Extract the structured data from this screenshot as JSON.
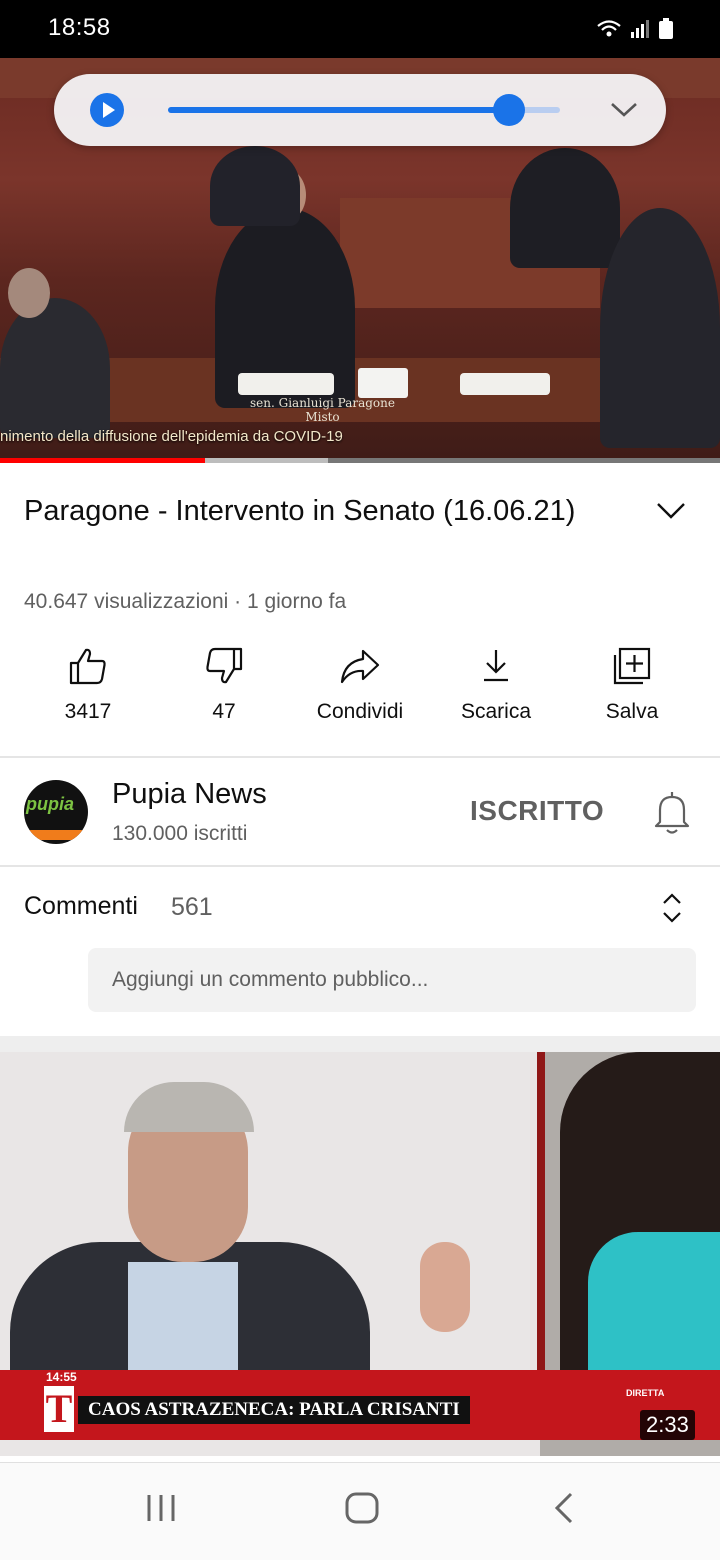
{
  "status_bar": {
    "time": "18:58",
    "icons": [
      "wifi-icon",
      "signal-icon",
      "battery-icon"
    ]
  },
  "video": {
    "caption": "nimento della diffusione dell'epidemia da COVID-19",
    "speaker_line1": "sen. Gianluigi Paragone",
    "speaker_line2": "Misto",
    "progress_played": 0.285,
    "progress_buffered": 0.455
  },
  "overlay": {
    "slider_value": 0.87,
    "accent_color": "#1a73e8",
    "icons": [
      "play-icon",
      "chevron-down-icon"
    ]
  },
  "title": {
    "text": "Paragone - Intervento in Senato (16.06.21)",
    "meta": "40.647 visualizzazioni · 1 giorno fa"
  },
  "actions": {
    "like": {
      "label": "3417",
      "icon": "thumbs-up-icon"
    },
    "dislike": {
      "label": "47",
      "icon": "thumbs-down-icon"
    },
    "share": {
      "label": "Condividi",
      "icon": "share-icon"
    },
    "download": {
      "label": "Scarica",
      "icon": "download-icon"
    },
    "save": {
      "label": "Salva",
      "icon": "add-to-playlist-icon"
    }
  },
  "channel": {
    "name": "Pupia News",
    "subscribers": "130.000 iscritti",
    "avatar_text": "pupia",
    "subscribe_label": "ISCRITTO",
    "bell_icon": "bell-icon"
  },
  "comments": {
    "label": "Commenti",
    "count": "561",
    "placeholder": "Aggiungi un commento pubblico..."
  },
  "next_video": {
    "tv_time": "14:55",
    "tv_logo": "T",
    "headline": "CAOS ASTRAZENECA: PARLA CRISANTI",
    "channel_badge": "DIRETTA",
    "duration": "2:33"
  },
  "navbar": {
    "icons": [
      "recent-apps-icon",
      "home-icon",
      "back-icon"
    ]
  }
}
